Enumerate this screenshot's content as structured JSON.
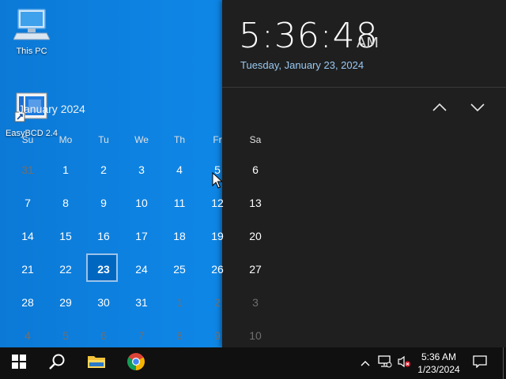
{
  "desktop": {
    "icons": [
      {
        "label": "This PC",
        "icon": "computer-icon"
      },
      {
        "label": "EasyBCD 2.4",
        "icon": "easybcd-icon"
      }
    ]
  },
  "flyout": {
    "time": "5:36:48",
    "ampm": "AM",
    "long_date": "Tuesday, January 23, 2024",
    "month_label": "January 2024",
    "weekdays": [
      "Su",
      "Mo",
      "Tu",
      "We",
      "Th",
      "Fr",
      "Sa"
    ],
    "days": [
      {
        "n": "31",
        "dim": true
      },
      {
        "n": "1"
      },
      {
        "n": "2"
      },
      {
        "n": "3"
      },
      {
        "n": "4"
      },
      {
        "n": "5"
      },
      {
        "n": "6"
      },
      {
        "n": "7"
      },
      {
        "n": "8"
      },
      {
        "n": "9"
      },
      {
        "n": "10"
      },
      {
        "n": "11"
      },
      {
        "n": "12"
      },
      {
        "n": "13"
      },
      {
        "n": "14"
      },
      {
        "n": "15"
      },
      {
        "n": "16"
      },
      {
        "n": "17"
      },
      {
        "n": "18"
      },
      {
        "n": "19"
      },
      {
        "n": "20"
      },
      {
        "n": "21"
      },
      {
        "n": "22"
      },
      {
        "n": "23",
        "today": true
      },
      {
        "n": "24"
      },
      {
        "n": "25"
      },
      {
        "n": "26"
      },
      {
        "n": "27"
      },
      {
        "n": "28"
      },
      {
        "n": "29"
      },
      {
        "n": "30"
      },
      {
        "n": "31"
      },
      {
        "n": "1",
        "dim": true
      },
      {
        "n": "2",
        "dim": true
      },
      {
        "n": "3",
        "dim": true
      },
      {
        "n": "4",
        "dim": true
      },
      {
        "n": "5",
        "dim": true
      },
      {
        "n": "6",
        "dim": true
      },
      {
        "n": "7",
        "dim": true
      },
      {
        "n": "8",
        "dim": true
      },
      {
        "n": "9",
        "dim": true
      },
      {
        "n": "10",
        "dim": true
      }
    ]
  },
  "taskbar": {
    "tray_time": "5:36 AM",
    "tray_date": "1/23/2024"
  },
  "colors": {
    "desktop": "#0c79d6",
    "flyout_bg": "#1f1f1f",
    "accent": "#0067c0",
    "date_link": "#99c9f2",
    "taskbar": "#101010"
  }
}
